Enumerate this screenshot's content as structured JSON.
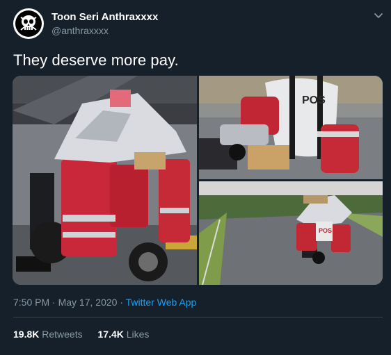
{
  "tweet": {
    "display_name": "Toon Seri Anthraxxxx",
    "handle": "@anthraxxxx",
    "text": "They deserve more pay.",
    "time": "7:50 PM",
    "separator": "·",
    "date": "May 17, 2020",
    "source": "Twitter Web App",
    "retweets_count": "19.8K",
    "retweets_label": "Retweets",
    "likes_count": "17.4K",
    "likes_label": "Likes"
  },
  "photos": {
    "bag_text_top": "POS",
    "bag_text_bottom": "POS"
  },
  "colors": {
    "background": "#15202b",
    "secondary_text": "#8899a6",
    "link": "#1da1f2",
    "divider": "#38444d"
  },
  "icons": [
    "avatar-skull-icon",
    "chevron-down-icon"
  ]
}
